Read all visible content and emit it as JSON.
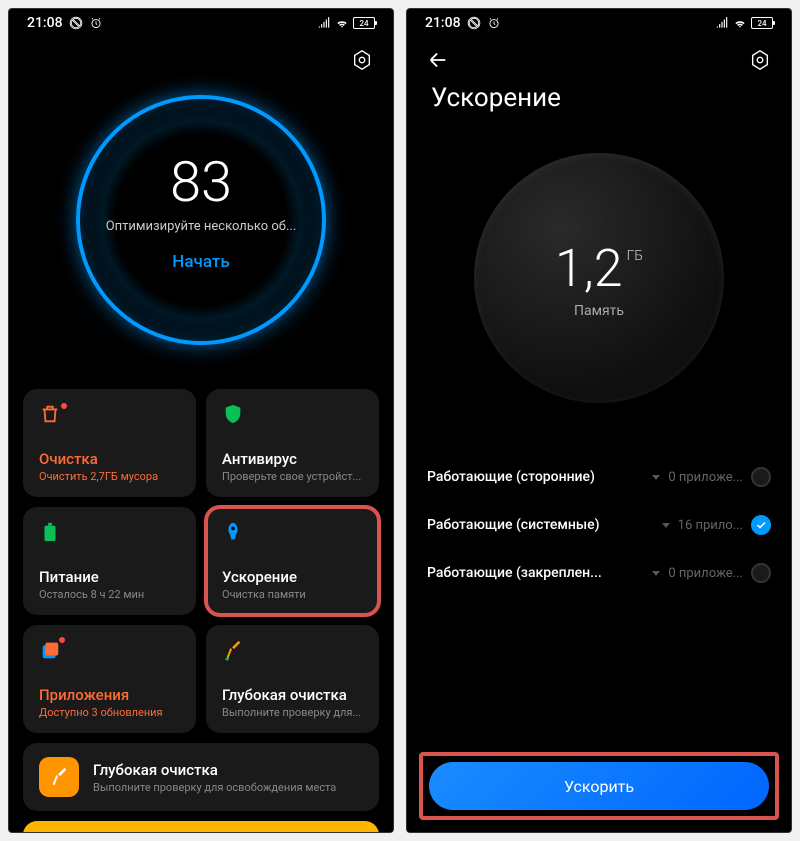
{
  "status": {
    "time": "21:08",
    "battery": "24"
  },
  "left": {
    "score": {
      "value": "83",
      "hint": "Оптимизируйте несколько об...",
      "button": "Начать"
    },
    "tiles": [
      {
        "title": "Очистка",
        "sub": "Очистить 2,7ГБ мусора",
        "accent": true
      },
      {
        "title": "Антивирус",
        "sub": "Проверьте свое устройст...",
        "accent": false
      },
      {
        "title": "Питание",
        "sub": "Осталось 8 ч 22 мин",
        "accent": false
      },
      {
        "title": "Ускорение",
        "sub": "Очистка памяти",
        "accent": false
      },
      {
        "title": "Приложения",
        "sub": "Доступно 3 обновления",
        "accent": true
      },
      {
        "title": "Глубокая очистка",
        "sub": "Выполните проверку для...",
        "accent": false
      }
    ],
    "deep": {
      "title": "Глубокая очистка",
      "sub": "Выполните проверку для освобождения места"
    }
  },
  "right": {
    "title": "Ускорение",
    "memory": {
      "value": "1,2",
      "unit": "ГБ",
      "label": "Память"
    },
    "rows": [
      {
        "label": "Работающие (сторонние)",
        "count": "0 приложе...",
        "checked": false
      },
      {
        "label": "Работающие (системные)",
        "count": "16 прило...",
        "checked": true
      },
      {
        "label": "Работающие (закреплен...",
        "count": "0 приложе...",
        "checked": false
      }
    ],
    "button": "Ускорить"
  }
}
